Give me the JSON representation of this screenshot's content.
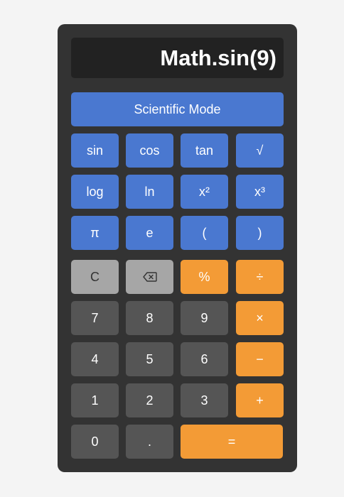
{
  "display": {
    "value": "Math.sin(9)"
  },
  "mode_button": {
    "label": "Scientific Mode"
  },
  "scientific": {
    "sin": "sin",
    "cos": "cos",
    "tan": "tan",
    "sqrt": "√",
    "log": "log",
    "ln": "ln",
    "square": "x²",
    "cube": "x³",
    "pi": "π",
    "e": "e",
    "open_paren": "(",
    "close_paren": ")"
  },
  "keys": {
    "clear": "C",
    "backspace_icon": "backspace-icon",
    "percent": "%",
    "divide": "÷",
    "multiply": "×",
    "minus": "−",
    "plus": "+",
    "equals": "=",
    "decimal": ".",
    "d0": "0",
    "d1": "1",
    "d2": "2",
    "d3": "3",
    "d4": "4",
    "d5": "5",
    "d6": "6",
    "d7": "7",
    "d8": "8",
    "d9": "9"
  },
  "colors": {
    "body": "#333333",
    "display": "#222222",
    "scientific": "#4a78d0",
    "number": "#555555",
    "operator": "#f39b36",
    "function": "#a6a6a6",
    "background": "#f4f4f4"
  }
}
